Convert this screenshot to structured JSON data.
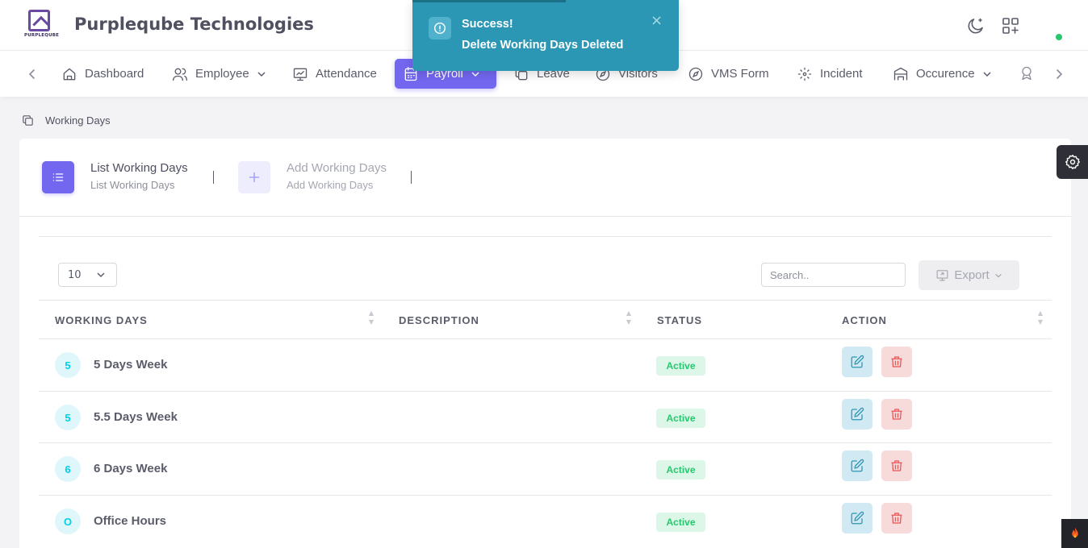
{
  "header": {
    "company_name": "Purpleqube Technologies",
    "logo_text": "PURPLEQUBE"
  },
  "toast": {
    "title": "Success!",
    "message": "Delete Working Days Deleted",
    "close": "×"
  },
  "nav": {
    "items": [
      {
        "label": "Dashboard",
        "icon": "home-icon"
      },
      {
        "label": "Employee",
        "icon": "users-icon",
        "dropdown": true
      },
      {
        "label": "Attendance",
        "icon": "presentation-icon"
      },
      {
        "label": "Payroll",
        "icon": "calendar-icon",
        "dropdown": true,
        "active": true
      },
      {
        "label": "Leave",
        "icon": "copy-icon"
      },
      {
        "label": "Visitors",
        "icon": "compass-icon"
      },
      {
        "label": "VMS Form",
        "icon": "compass-icon"
      },
      {
        "label": "Incident",
        "icon": "focus-icon"
      },
      {
        "label": "Occurence",
        "icon": "building-icon",
        "dropdown": true
      }
    ]
  },
  "breadcrumb": {
    "label": "Working Days"
  },
  "tabs": [
    {
      "title": "List Working Days",
      "subtitle": "List Working Days"
    },
    {
      "title": "Add Working Days",
      "subtitle": "Add Working Days"
    }
  ],
  "table_controls": {
    "page_length": "10",
    "search_placeholder": "Search..",
    "export_label": "Export"
  },
  "table": {
    "headers": [
      "WORKING DAYS",
      "DESCRIPTION",
      "STATUS",
      "ACTION"
    ],
    "rows": [
      {
        "avatar": "5",
        "name": "5 Days Week",
        "description": "",
        "status": "Active"
      },
      {
        "avatar": "5",
        "name": "5.5 Days Week",
        "description": "",
        "status": "Active"
      },
      {
        "avatar": "6",
        "name": "6 Days Week",
        "description": "",
        "status": "Active"
      },
      {
        "avatar": "O",
        "name": "Office Hours",
        "description": "",
        "status": "Active"
      }
    ]
  },
  "colors": {
    "primary": "#7367f0",
    "toast": "#2c97b4",
    "success": "#28c76f",
    "danger": "#ea5455",
    "info": "#00cfe8"
  }
}
